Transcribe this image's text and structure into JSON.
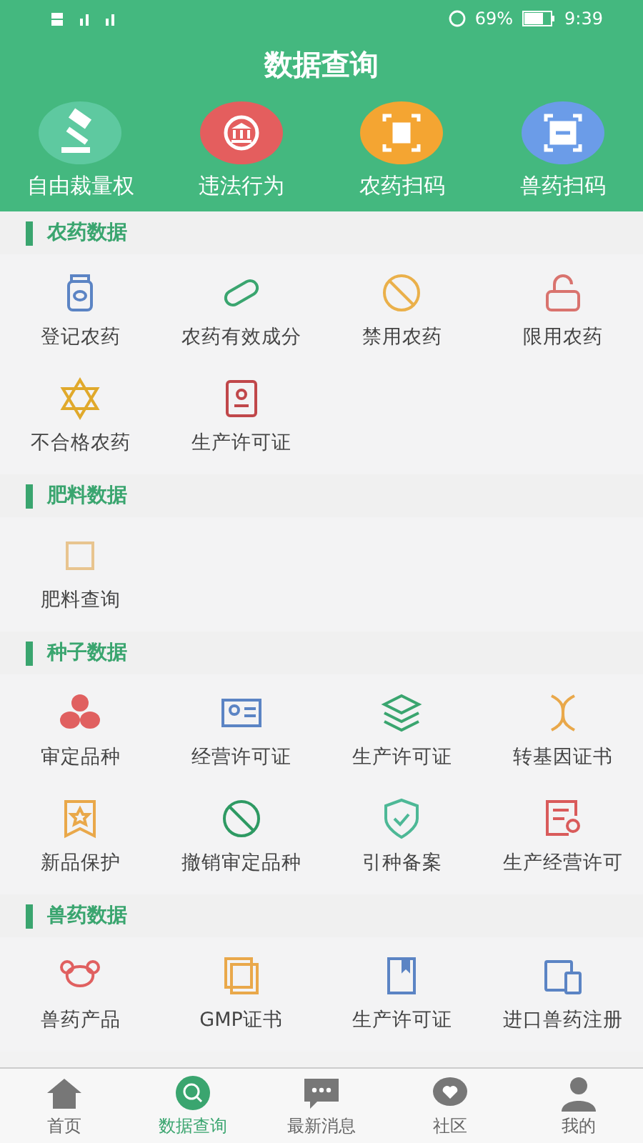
{
  "status_bar": {
    "time": "9:39",
    "battery": "69%"
  },
  "title": "数据查询",
  "quick_actions": [
    {
      "label": "自由裁量权",
      "color": "#5ec9a0"
    },
    {
      "label": "违法行为",
      "color": "#e45e5e"
    },
    {
      "label": "农药扫码",
      "color": "#f4a532"
    },
    {
      "label": "兽药扫码",
      "color": "#6b9ce8"
    }
  ],
  "sections": [
    {
      "title": "农药数据",
      "items": [
        "登记农药",
        "农药有效成分",
        "禁用农药",
        "限用农药",
        "不合格农药",
        "生产许可证"
      ]
    },
    {
      "title": "肥料数据",
      "items": [
        "肥料查询"
      ]
    },
    {
      "title": "种子数据",
      "items": [
        "审定品种",
        "经营许可证",
        "生产许可证",
        "转基因证书",
        "新品保护",
        "撤销审定品种",
        "引种备案",
        "生产经营许可"
      ]
    },
    {
      "title": "兽药数据",
      "items": [
        "兽药产品",
        "GMP证书",
        "生产许可证",
        "进口兽药注册"
      ]
    }
  ],
  "tabs": [
    {
      "label": "首页",
      "selected": false
    },
    {
      "label": "数据查询",
      "selected": true
    },
    {
      "label": "最新消息",
      "selected": false
    },
    {
      "label": "社区",
      "selected": false
    },
    {
      "label": "我的",
      "selected": false
    }
  ]
}
